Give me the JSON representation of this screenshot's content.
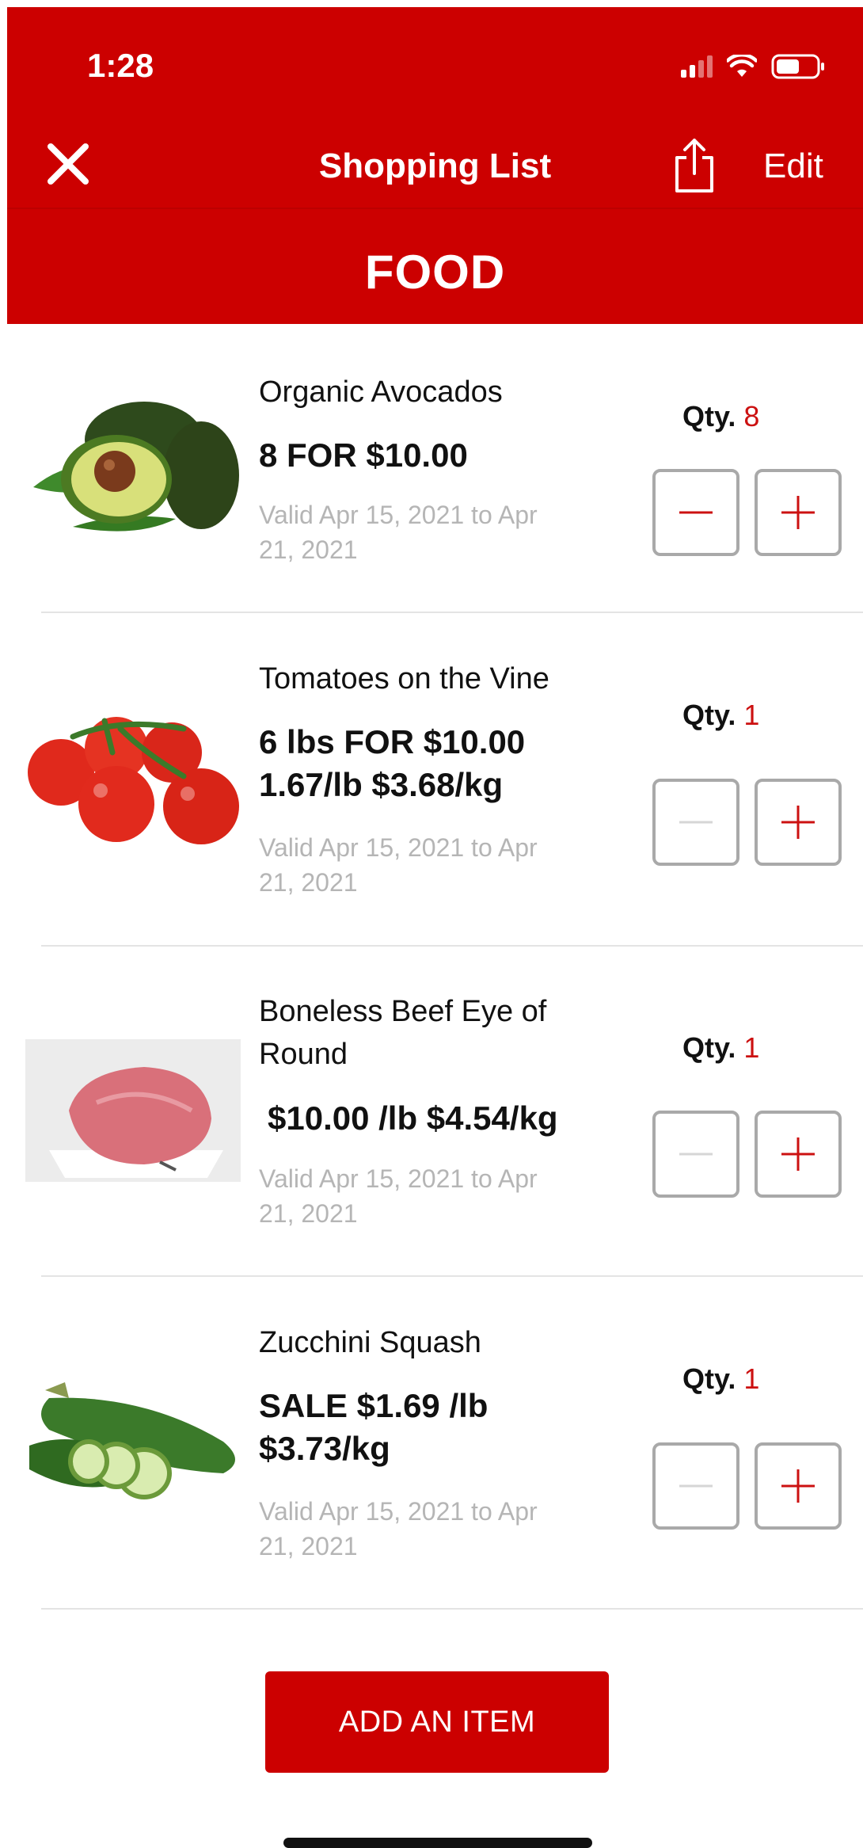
{
  "status_bar": {
    "time": "1:28"
  },
  "nav": {
    "title": "Shopping List",
    "edit_label": "Edit"
  },
  "section": {
    "title": "FOOD"
  },
  "items": [
    {
      "name": "Organic Avocados",
      "price": "8 FOR $10.00",
      "valid": "Valid Apr 15, 2021 to Apr 21, 2021",
      "qty_label": "Qty.",
      "qty": "8",
      "image": "avocado"
    },
    {
      "name": "Tomatoes on the Vine",
      "price": "6 lbs FOR $10.00 1.67/lb $3.68/kg",
      "valid": "Valid Apr 15, 2021 to Apr 21, 2021",
      "qty_label": "Qty.",
      "qty": "1",
      "image": "tomatoes"
    },
    {
      "name": "Boneless Beef Eye of Round",
      "price": "$10.00 /lb $4.54/kg",
      "valid": "Valid Apr 15, 2021 to Apr 21, 2021",
      "qty_label": "Qty.",
      "qty": "1",
      "image": "beef"
    },
    {
      "name": "Zucchini Squash",
      "price": "SALE $1.69 /lb $3.73/kg",
      "valid": "Valid Apr 15, 2021 to Apr 21, 2021",
      "qty_label": "Qty.",
      "qty": "1",
      "image": "zucchini"
    }
  ],
  "add_button": {
    "label": "ADD AN ITEM"
  },
  "colors": {
    "brand_red": "#cc0000",
    "qty_red": "#cc1111",
    "disabled_gray": "#d6d6d6",
    "border_gray": "#a9a9a9"
  },
  "icons": {
    "close": "close-icon",
    "share": "share-icon",
    "minus": "minus-icon",
    "plus": "plus-icon"
  }
}
